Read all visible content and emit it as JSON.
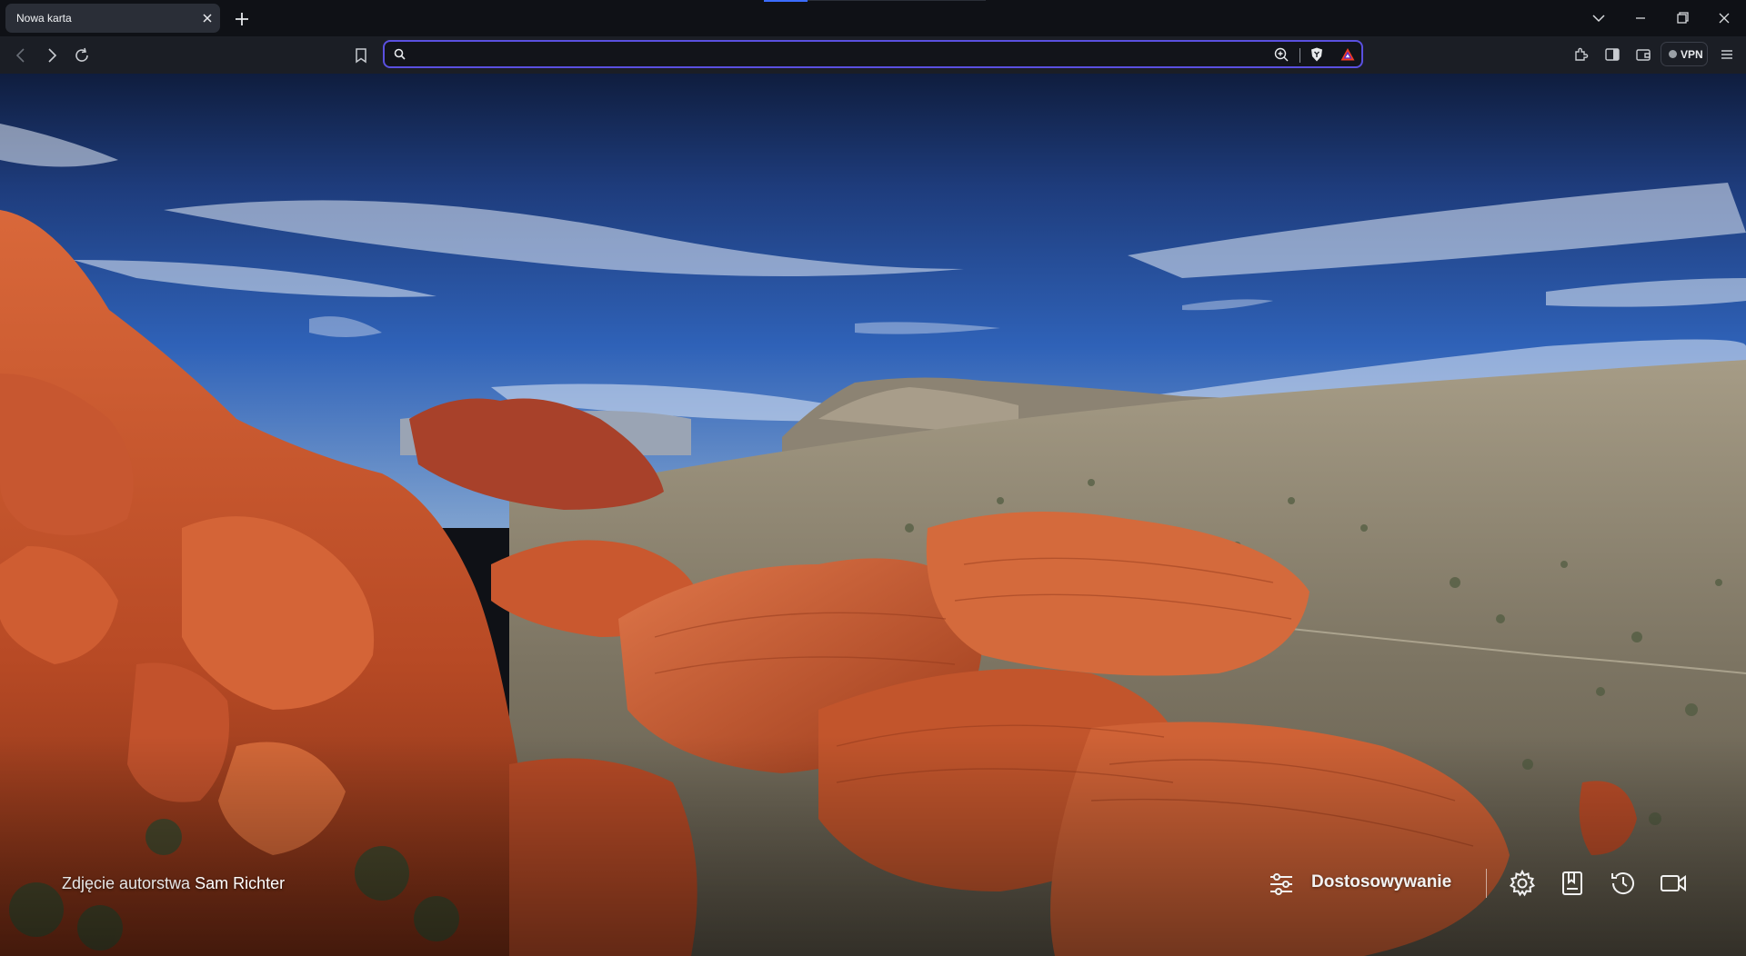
{
  "tab": {
    "title": "Nowa karta",
    "close_icon": "close-icon"
  },
  "toolbar": {
    "url_value": "",
    "url_placeholder": "",
    "vpn_label": "VPN"
  },
  "credit": {
    "prefix": "Zdjęcie autorstwa",
    "author": "Sam Richter"
  },
  "bottom": {
    "customize_label": "Dostosowywanie"
  },
  "colors": {
    "accent": "#5a50e0",
    "tab_bg": "#2a2e37",
    "toolbar_bg": "#1b1e25",
    "strip_bg": "#0f1116"
  }
}
